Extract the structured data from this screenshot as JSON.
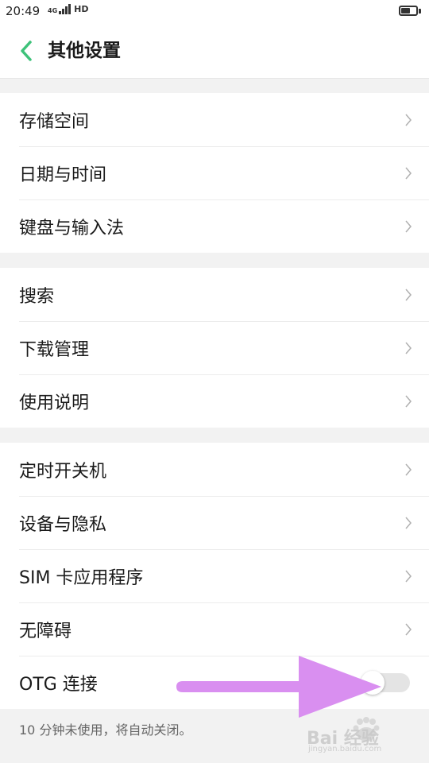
{
  "status": {
    "time": "20:49",
    "network": "4G",
    "hd": "HD",
    "battery_level": 0.6
  },
  "header": {
    "back_icon": "chevron-left-icon",
    "title": "其他设置"
  },
  "accent_color": "#3ec27a",
  "groups": [
    {
      "items": [
        {
          "label": "存储空间"
        },
        {
          "label": "日期与时间"
        },
        {
          "label": "键盘与输入法"
        }
      ]
    },
    {
      "items": [
        {
          "label": "搜索"
        },
        {
          "label": "下载管理"
        },
        {
          "label": "使用说明"
        }
      ]
    },
    {
      "items": [
        {
          "label": "定时开关机"
        },
        {
          "label": "设备与隐私"
        },
        {
          "label": "SIM 卡应用程序"
        },
        {
          "label": "无障碍"
        }
      ]
    }
  ],
  "otg": {
    "label": "OTG 连接",
    "enabled": false,
    "note": "10 分钟未使用，将自动关闭。"
  },
  "overlay": {
    "arrow_color": "#d98ff0"
  },
  "watermark": {
    "text": "Bai 经验",
    "sub": "jingyan.baidu.com"
  }
}
